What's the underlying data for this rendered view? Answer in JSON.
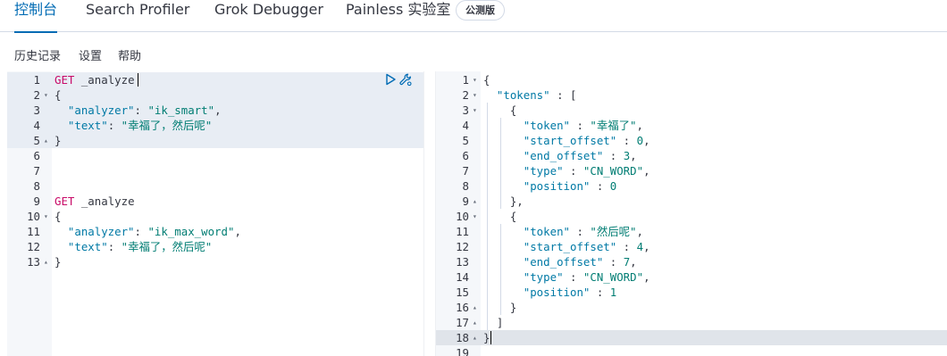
{
  "tabs": {
    "console": "控制台",
    "profiler": "Search Profiler",
    "grok": "Grok Debugger",
    "painless": "Painless 实验室",
    "beta_badge": "公测版"
  },
  "menu": {
    "history": "历史记录",
    "settings": "设置",
    "help": "帮助"
  },
  "request_editor": {
    "lines": [
      {
        "n": "1",
        "fold": "",
        "tokens": [
          [
            "k-method",
            "GET"
          ],
          [
            "k-url",
            " _analyze"
          ]
        ]
      },
      {
        "n": "2",
        "fold": "▾",
        "tokens": [
          [
            "k-punc",
            "{"
          ]
        ]
      },
      {
        "n": "3",
        "fold": "",
        "tokens": [
          [
            "k-punc",
            "  "
          ],
          [
            "k-key",
            "\"analyzer\""
          ],
          [
            "k-punc",
            ": "
          ],
          [
            "k-str",
            "\"ik_smart\""
          ],
          [
            "k-punc",
            ","
          ]
        ]
      },
      {
        "n": "4",
        "fold": "",
        "tokens": [
          [
            "k-punc",
            "  "
          ],
          [
            "k-key",
            "\"text\""
          ],
          [
            "k-punc",
            ": "
          ],
          [
            "k-str",
            "\"幸福了，然后呢\""
          ]
        ]
      },
      {
        "n": "5",
        "fold": "▴",
        "tokens": [
          [
            "k-punc",
            "}"
          ]
        ]
      },
      {
        "n": "6",
        "fold": "",
        "tokens": []
      },
      {
        "n": "7",
        "fold": "",
        "tokens": []
      },
      {
        "n": "8",
        "fold": "",
        "tokens": []
      },
      {
        "n": "9",
        "fold": "",
        "tokens": [
          [
            "k-method",
            "GET"
          ],
          [
            "k-url",
            " _analyze"
          ]
        ]
      },
      {
        "n": "10",
        "fold": "▾",
        "tokens": [
          [
            "k-punc",
            "{"
          ]
        ]
      },
      {
        "n": "11",
        "fold": "",
        "tokens": [
          [
            "k-punc",
            "  "
          ],
          [
            "k-key",
            "\"analyzer\""
          ],
          [
            "k-punc",
            ": "
          ],
          [
            "k-str",
            "\"ik_max_word\""
          ],
          [
            "k-punc",
            ","
          ]
        ]
      },
      {
        "n": "12",
        "fold": "",
        "tokens": [
          [
            "k-punc",
            "  "
          ],
          [
            "k-key",
            "\"text\""
          ],
          [
            "k-punc",
            ": "
          ],
          [
            "k-str",
            "\"幸福了，然后呢\""
          ]
        ]
      },
      {
        "n": "13",
        "fold": "▴",
        "tokens": [
          [
            "k-punc",
            "}"
          ]
        ]
      }
    ]
  },
  "response_viewer": {
    "lines": [
      {
        "n": "1",
        "fold": "▾",
        "tokens": [
          [
            "k-punc",
            "{"
          ]
        ]
      },
      {
        "n": "2",
        "fold": "▾",
        "tokens": [
          [
            "k-punc",
            "  "
          ],
          [
            "k-key",
            "\"tokens\""
          ],
          [
            "k-punc",
            " : ["
          ]
        ]
      },
      {
        "n": "3",
        "fold": "▾",
        "tokens": [
          [
            "k-punc",
            "    {"
          ]
        ]
      },
      {
        "n": "4",
        "fold": "",
        "tokens": [
          [
            "k-punc",
            "      "
          ],
          [
            "k-key",
            "\"token\""
          ],
          [
            "k-punc",
            " : "
          ],
          [
            "k-str",
            "\"幸福了\""
          ],
          [
            "k-punc",
            ","
          ]
        ]
      },
      {
        "n": "5",
        "fold": "",
        "tokens": [
          [
            "k-punc",
            "      "
          ],
          [
            "k-key",
            "\"start_offset\""
          ],
          [
            "k-punc",
            " : "
          ],
          [
            "k-num",
            "0"
          ],
          [
            "k-punc",
            ","
          ]
        ]
      },
      {
        "n": "6",
        "fold": "",
        "tokens": [
          [
            "k-punc",
            "      "
          ],
          [
            "k-key",
            "\"end_offset\""
          ],
          [
            "k-punc",
            " : "
          ],
          [
            "k-num",
            "3"
          ],
          [
            "k-punc",
            ","
          ]
        ]
      },
      {
        "n": "7",
        "fold": "",
        "tokens": [
          [
            "k-punc",
            "      "
          ],
          [
            "k-key",
            "\"type\""
          ],
          [
            "k-punc",
            " : "
          ],
          [
            "k-str",
            "\"CN_WORD\""
          ],
          [
            "k-punc",
            ","
          ]
        ]
      },
      {
        "n": "8",
        "fold": "",
        "tokens": [
          [
            "k-punc",
            "      "
          ],
          [
            "k-key",
            "\"position\""
          ],
          [
            "k-punc",
            " : "
          ],
          [
            "k-num",
            "0"
          ]
        ]
      },
      {
        "n": "9",
        "fold": "▴",
        "tokens": [
          [
            "k-punc",
            "    },"
          ]
        ]
      },
      {
        "n": "10",
        "fold": "▾",
        "tokens": [
          [
            "k-punc",
            "    {"
          ]
        ]
      },
      {
        "n": "11",
        "fold": "",
        "tokens": [
          [
            "k-punc",
            "      "
          ],
          [
            "k-key",
            "\"token\""
          ],
          [
            "k-punc",
            " : "
          ],
          [
            "k-str",
            "\"然后呢\""
          ],
          [
            "k-punc",
            ","
          ]
        ]
      },
      {
        "n": "12",
        "fold": "",
        "tokens": [
          [
            "k-punc",
            "      "
          ],
          [
            "k-key",
            "\"start_offset\""
          ],
          [
            "k-punc",
            " : "
          ],
          [
            "k-num",
            "4"
          ],
          [
            "k-punc",
            ","
          ]
        ]
      },
      {
        "n": "13",
        "fold": "",
        "tokens": [
          [
            "k-punc",
            "      "
          ],
          [
            "k-key",
            "\"end_offset\""
          ],
          [
            "k-punc",
            " : "
          ],
          [
            "k-num",
            "7"
          ],
          [
            "k-punc",
            ","
          ]
        ]
      },
      {
        "n": "14",
        "fold": "",
        "tokens": [
          [
            "k-punc",
            "      "
          ],
          [
            "k-key",
            "\"type\""
          ],
          [
            "k-punc",
            " : "
          ],
          [
            "k-str",
            "\"CN_WORD\""
          ],
          [
            "k-punc",
            ","
          ]
        ]
      },
      {
        "n": "15",
        "fold": "",
        "tokens": [
          [
            "k-punc",
            "      "
          ],
          [
            "k-key",
            "\"position\""
          ],
          [
            "k-punc",
            " : "
          ],
          [
            "k-num",
            "1"
          ]
        ]
      },
      {
        "n": "16",
        "fold": "▴",
        "tokens": [
          [
            "k-punc",
            "    }"
          ]
        ]
      },
      {
        "n": "17",
        "fold": "▴",
        "tokens": [
          [
            "k-punc",
            "  ]"
          ]
        ]
      },
      {
        "n": "18",
        "fold": "▴",
        "tokens": [
          [
            "k-punc",
            "}"
          ]
        ]
      },
      {
        "n": "19",
        "fold": "",
        "tokens": []
      }
    ]
  },
  "icons": {
    "run": "play-icon",
    "wrench": "wrench-icon"
  },
  "colors": {
    "accent": "#006bb4",
    "method": "#c80a68",
    "key": "#0079a5",
    "string": "#017d73"
  }
}
